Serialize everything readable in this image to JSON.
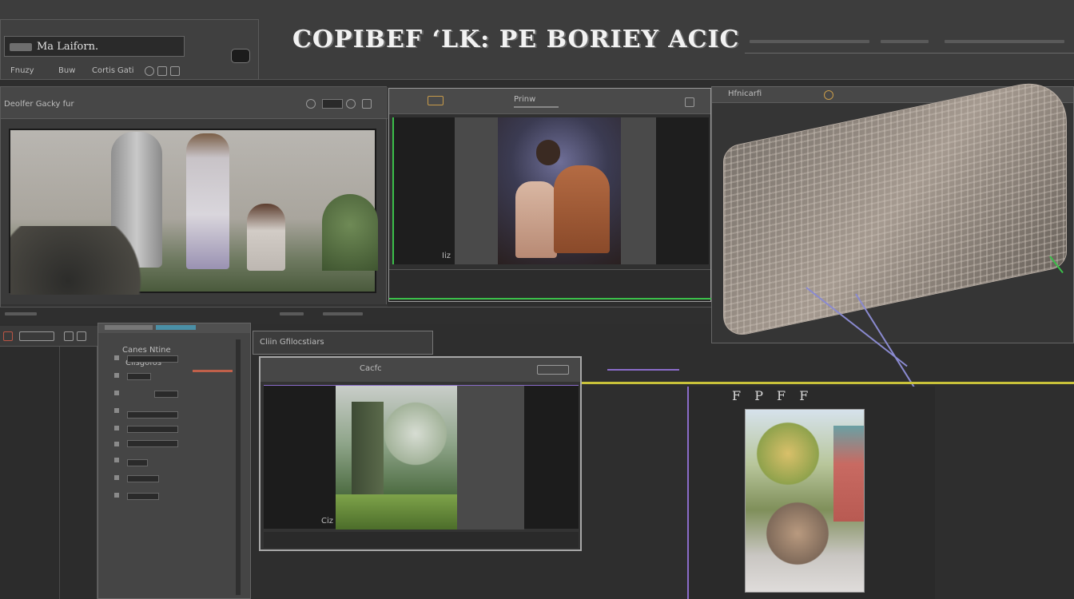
{
  "app": {
    "title": "COPIBEF ‘LK: PE  BORIEY ACIC",
    "file_label": "Ma Laiforn.",
    "menu": [
      "Fnuzy",
      "Buw",
      "Cortis",
      "Gati"
    ]
  },
  "preview_main": {
    "tab_label": "Deolfer Gacky fur"
  },
  "preview_top": {
    "header_text": "Prinw",
    "corner_label": "Iiz"
  },
  "preview_right": {
    "header_text": "Hfnicarfi"
  },
  "properties": {
    "header_text": "Canes Ntine",
    "section_label": "Ciisgofos"
  },
  "preview_bottom": {
    "header_text": "Cliin Gfilocstiars",
    "sub_label": "Cacfc",
    "corner_label": "Ciz"
  },
  "preview_small": {
    "header_text": "F P F F"
  },
  "colors": {
    "accent_green": "#3bbf4a",
    "accent_yellow": "#c9c23a",
    "accent_purple": "#8a6cc9",
    "accent_cyan": "#4a8fa6"
  }
}
